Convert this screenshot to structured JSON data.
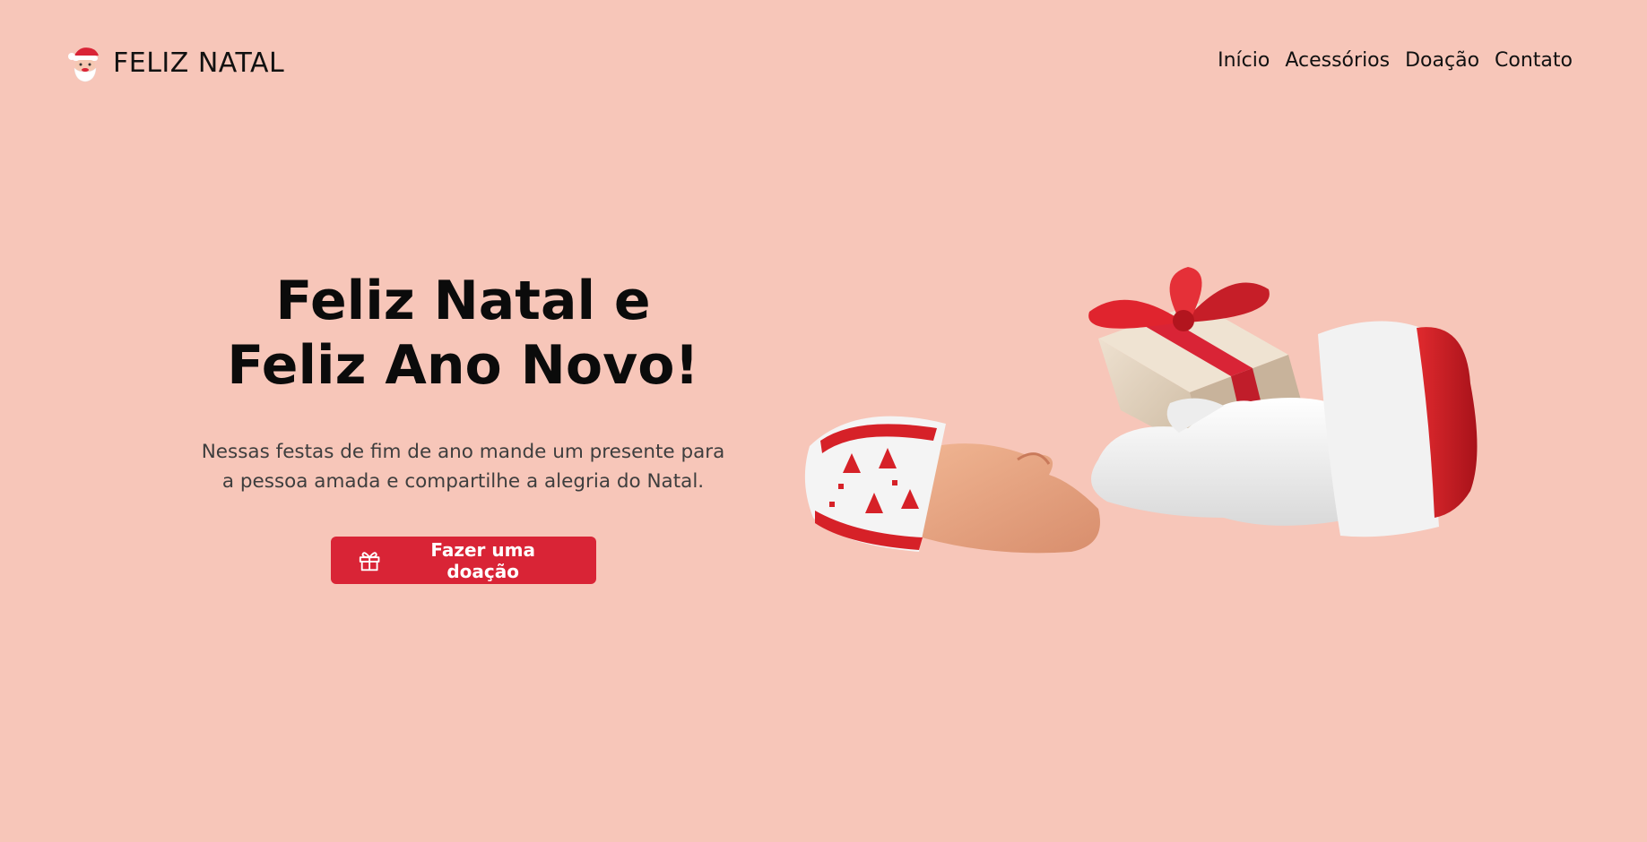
{
  "header": {
    "brand": {
      "icon": "santa-icon",
      "text": "FELIZ NATAL"
    },
    "nav": [
      {
        "label": "Início"
      },
      {
        "label": "Acessórios"
      },
      {
        "label": "Doação"
      },
      {
        "label": "Contato"
      }
    ]
  },
  "hero": {
    "title_line1": "Feliz Natal e",
    "title_line2": "Feliz Ano Novo!",
    "description_line1": "Nessas festas de fim de ano mande um presente para",
    "description_line2": "a pessoa amada e compartilhe a alegria do Natal.",
    "cta": {
      "icon": "gift-icon",
      "label": "Fazer uma doação"
    },
    "illustration": "hands-exchanging-gift"
  },
  "colors": {
    "background": "#f7c6b9",
    "accent": "#d92436",
    "text": "#111111"
  }
}
